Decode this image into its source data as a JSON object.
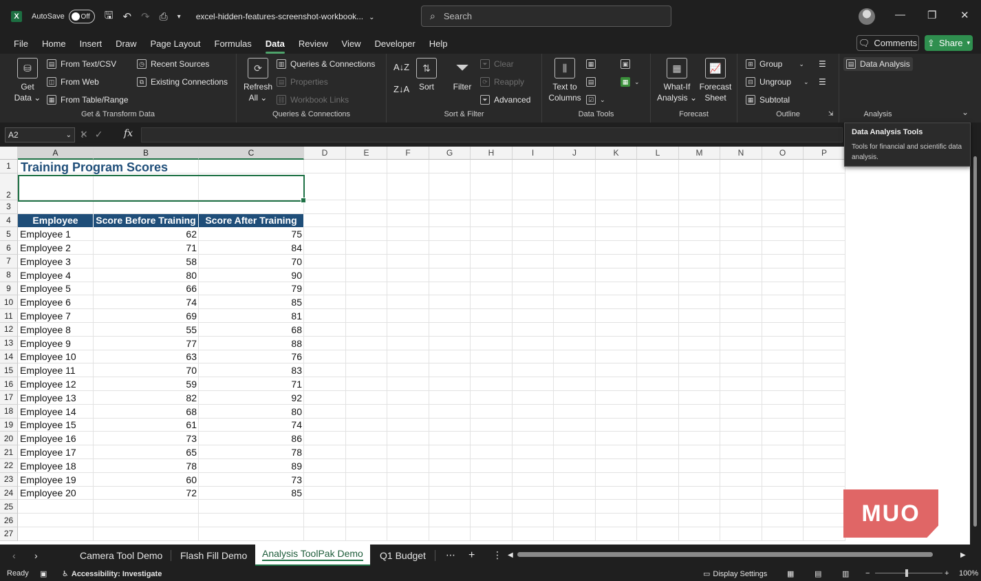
{
  "titlebar": {
    "autosave_label": "AutoSave",
    "autosave_state": "Off",
    "filename": "excel-hidden-features-screenshot-workbook...",
    "search_placeholder": "Search"
  },
  "menu": [
    "File",
    "Home",
    "Insert",
    "Draw",
    "Page Layout",
    "Formulas",
    "Data",
    "Review",
    "View",
    "Developer",
    "Help"
  ],
  "menu_active": "Data",
  "actions": {
    "comments": "Comments",
    "share": "Share"
  },
  "ribbon": {
    "get_data": {
      "line1": "Get",
      "line2": "Data ⌄"
    },
    "get_transform": {
      "from_text": "From Text/CSV",
      "from_web": "From Web",
      "from_table": "From Table/Range",
      "recent": "Recent Sources",
      "existing": "Existing Connections",
      "label": "Get & Transform Data"
    },
    "refresh": {
      "line1": "Refresh",
      "line2": "All ⌄"
    },
    "queries": {
      "queries": "Queries & Connections",
      "properties": "Properties",
      "links": "Workbook Links",
      "label": "Queries & Connections"
    },
    "sort_filter": {
      "sort": "Sort",
      "filter": "Filter",
      "clear": "Clear",
      "reapply": "Reapply",
      "advanced": "Advanced",
      "label": "Sort & Filter"
    },
    "data_tools": {
      "ttc_line1": "Text to",
      "ttc_line2": "Columns",
      "label": "Data Tools"
    },
    "forecast": {
      "whatif_line1": "What-If",
      "whatif_line2": "Analysis ⌄",
      "sheet_line1": "Forecast",
      "sheet_line2": "Sheet",
      "label": "Forecast"
    },
    "outline": {
      "group": "Group",
      "ungroup": "Ungroup",
      "subtotal": "Subtotal",
      "label": "Outline"
    },
    "analysis": {
      "data_analysis": "Data Analysis",
      "label": "Analysis"
    }
  },
  "tooltip": {
    "title": "Data Analysis Tools",
    "body": "Tools for financial and scientific data analysis."
  },
  "formula_bar": {
    "name_box": "A2",
    "fx": "fx"
  },
  "columns": [
    "A",
    "B",
    "C",
    "D",
    "E",
    "F",
    "G",
    "H",
    "I",
    "J",
    "K",
    "L",
    "M",
    "N",
    "O",
    "P"
  ],
  "sheet": {
    "title": "Training Program Scores",
    "headers": [
      "Employee",
      "Score Before Training",
      "Score After Training"
    ],
    "rows": [
      [
        "Employee 1",
        "62",
        "75"
      ],
      [
        "Employee 2",
        "71",
        "84"
      ],
      [
        "Employee 3",
        "58",
        "70"
      ],
      [
        "Employee 4",
        "80",
        "90"
      ],
      [
        "Employee 5",
        "66",
        "79"
      ],
      [
        "Employee 6",
        "74",
        "85"
      ],
      [
        "Employee 7",
        "69",
        "81"
      ],
      [
        "Employee 8",
        "55",
        "68"
      ],
      [
        "Employee 9",
        "77",
        "88"
      ],
      [
        "Employee 10",
        "63",
        "76"
      ],
      [
        "Employee 11",
        "70",
        "83"
      ],
      [
        "Employee 12",
        "59",
        "71"
      ],
      [
        "Employee 13",
        "82",
        "92"
      ],
      [
        "Employee 14",
        "68",
        "80"
      ],
      [
        "Employee 15",
        "61",
        "74"
      ],
      [
        "Employee 16",
        "73",
        "86"
      ],
      [
        "Employee 17",
        "65",
        "78"
      ],
      [
        "Employee 18",
        "78",
        "89"
      ],
      [
        "Employee 19",
        "60",
        "73"
      ],
      [
        "Employee 20",
        "72",
        "85"
      ]
    ]
  },
  "watermark": "MUO",
  "tabs": [
    "Camera Tool Demo",
    "Flash Fill Demo",
    "Analysis ToolPak Demo",
    "Q1 Budget"
  ],
  "active_tab": "Analysis ToolPak Demo",
  "status": {
    "ready": "Ready",
    "accessibility": "Accessibility: Investigate",
    "display_settings": "Display Settings",
    "zoom": "100%"
  },
  "colors": {
    "accent_green": "#1e7145",
    "header_blue": "#1f4e79",
    "share_green": "#2f8f4f"
  }
}
